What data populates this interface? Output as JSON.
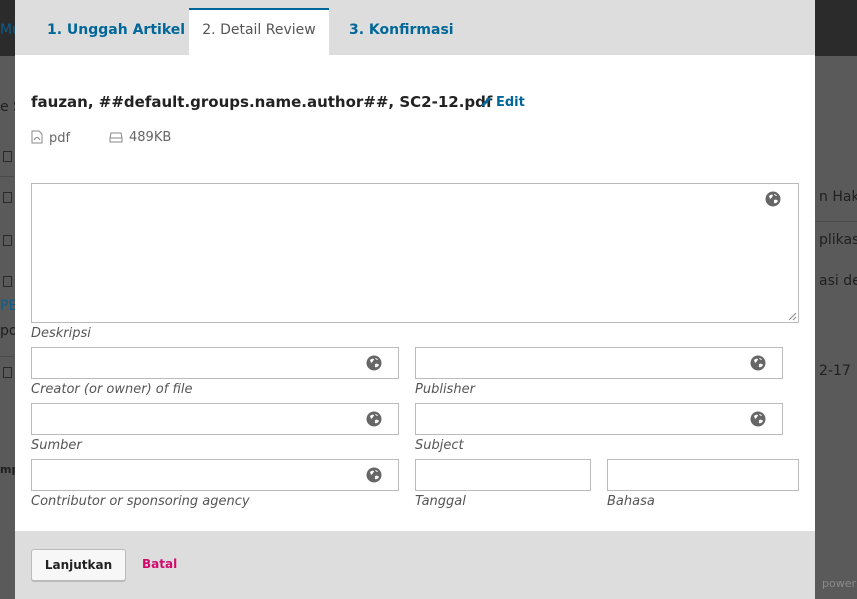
{
  "background": {
    "fragments": [
      "Mu",
      "e S",
      "n Hak",
      "plikasi",
      "asi de",
      "PE",
      "po",
      "2-17",
      "mp",
      "power"
    ]
  },
  "tabs": [
    {
      "label": "1. Unggah Artikel"
    },
    {
      "label": "2. Detail Review"
    },
    {
      "label": "3. Konfirmasi"
    }
  ],
  "file": {
    "title": "fauzan, ##default.groups.name.author##, SC2-12.pdf",
    "edit_label": "Edit",
    "type": "pdf",
    "size": "489KB"
  },
  "form": {
    "description_label": "Deskripsi",
    "fields": {
      "creator": "Creator (or owner) of file",
      "publisher": "Publisher",
      "source": "Sumber",
      "subject": "Subject",
      "contributor": "Contributor or sponsoring agency",
      "date": "Tanggal",
      "language": "Bahasa"
    }
  },
  "footer": {
    "continue_label": "Lanjutkan",
    "cancel_label": "Batal"
  },
  "colors": {
    "accent": "#006798",
    "cancel": "#d00a6c",
    "tab_bar": "#dddddd"
  }
}
